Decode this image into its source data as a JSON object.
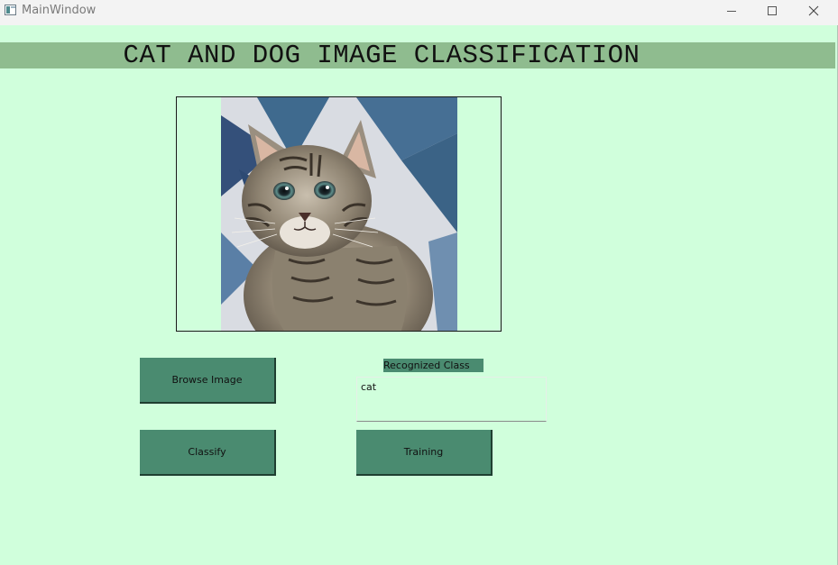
{
  "window": {
    "title": "MainWindow"
  },
  "banner": {
    "title": "CAT AND DOG IMAGE CLASSIFICATION"
  },
  "buttons": {
    "browse": "Browse Image",
    "classify": "Classify",
    "training": "Training"
  },
  "result": {
    "label": "Recognized Class",
    "value": "cat"
  },
  "colors": {
    "background": "#d0ffdc",
    "banner": "#8fbc8f",
    "button": "#4a8b70"
  }
}
